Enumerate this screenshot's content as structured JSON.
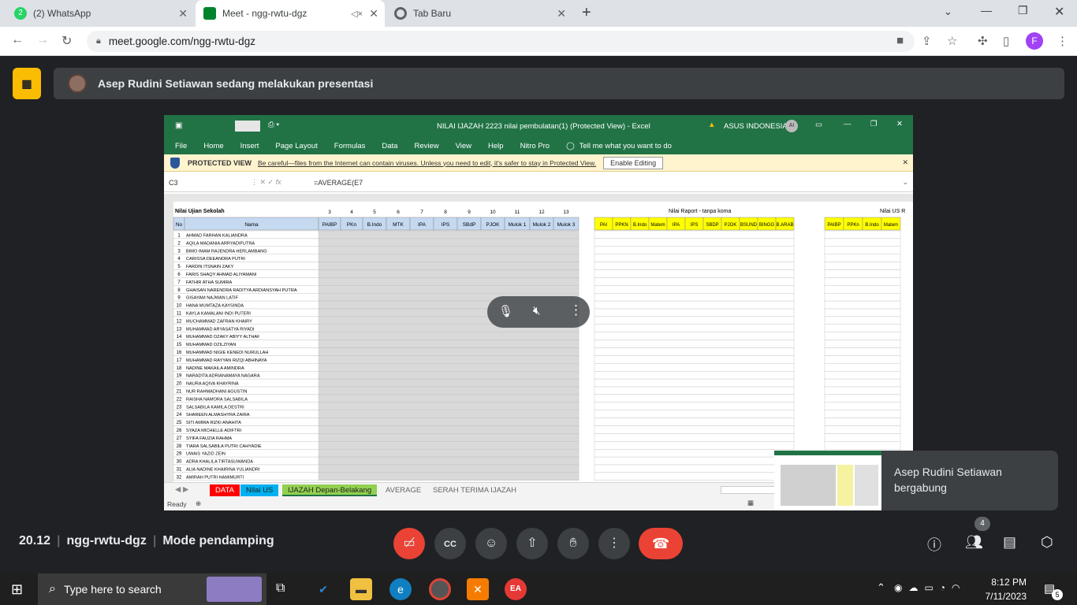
{
  "browser": {
    "tabs": [
      {
        "label": "(2) WhatsApp",
        "badge": "2",
        "icon": "whatsapp-icon",
        "color": "#25d366"
      },
      {
        "label": "Meet - ngg-rwtu-dgz",
        "icon": "meet-icon",
        "color": "#00832d"
      },
      {
        "label": "Tab Baru",
        "icon": "chrome-icon",
        "color": "#5f6368"
      }
    ],
    "url": "meet.google.com/ngg-rwtu-dgz",
    "avatar_letter": "F"
  },
  "presentation": {
    "banner": "Asep Rudini Setiawan sedang melakukan presentasi"
  },
  "excel": {
    "title": "NILAI IJAZAH 2223 nilai pembulatan(1)  (Protected View)  -  Excel",
    "account": "ASUS INDONESIA",
    "account_initials": "AI",
    "ribbon_tabs": [
      "File",
      "Home",
      "Insert",
      "Page Layout",
      "Formulas",
      "Data",
      "Review",
      "View",
      "Help",
      "Nitro Pro",
      "Tell me what you want to do"
    ],
    "protected_label": "PROTECTED VIEW",
    "protected_msg": "Be careful—files from the Internet can contain viruses. Unless you need to edit, it's safer to stay in Protected View.",
    "enable_button": "Enable Editing",
    "name_box": "C3",
    "formula": "=AVERAGE(E7",
    "section_left": "Nilai Ujian Sekolah",
    "section_mid": "Nilai Raport - tanpa koma",
    "section_right": "Nilai US R",
    "left_headers": [
      "No",
      "Nama",
      "PAIBP",
      "PKn",
      "B.Indo",
      "MTK",
      "IPA",
      "IPS",
      "SBdP",
      "PJOK",
      "Mulok 1",
      "Mulok 2",
      "Mulok 3"
    ],
    "col_numbers": [
      "3",
      "4",
      "5",
      "6",
      "7",
      "8",
      "9",
      "10",
      "11",
      "12",
      "13"
    ],
    "mid_headers": [
      "PAI",
      "PPKN",
      "B.Indo",
      "Matem",
      "IPA",
      "IPS",
      "SBDP",
      "PJOK",
      "BSUND",
      "BINGG",
      "B.ARAB"
    ],
    "right_headers": [
      "PAIBP",
      "PPKn",
      "B.Indo",
      "Matem"
    ],
    "students": [
      "AHMAD FARHAN KALIANDRA",
      "AQILA MADANIA ARRYADIFUTRA",
      "BIMO IMAM RAJENDRA HERLAMBANG",
      "CARISSA DEEANDRA PUTRI",
      "FARDIN ITSNAIN ZAKY",
      "FARIS SHAQY AHMAD ALIYAMANI",
      "FATHIR ATHA SUMIRA",
      "GHAISAN NARENDRA RADITYA ARDIANSYAH PUTRA",
      "GISAYAM NAJWAN LATIF",
      "HANA MUMTAZA KAYSINDA",
      "KAYLA KAMALANI INDI PUTERI",
      "MUCHAMMAD ZAFRAN KHAIRY",
      "MUHAMMAD ARYASATYA RIYADI",
      "MUHAMMAD DZAKY ABIYY ALTHAF",
      "MUHAMMAD DZILZIYAN",
      "MUHAMMAD NIGIE KENEDI NURULLAH",
      "MUHAMMAD RAYYAN RIZQI ABHINAYA",
      "NADINE MAKAILA AMINDRA",
      "NARADITA ADRIANAMAYA NAGARA",
      "NAURA AQIVA KHAYRINA",
      "NUR RAHMADHANI AGUSTIN",
      "RAISHA NAMORA SALSABILA",
      "SALSABILA KAMILA DESTRI",
      "SHAREEN ALMASHYRA ZAIRA",
      "SITI AMIRA RIZKI ANAHITA",
      "SYAZA MICHELLE ADIFTRI",
      "SYIFA FAUZIA RAHMA",
      "TIARA SALSABILA PUTRI CAHYADIE",
      "UWAIS YAZID ZEIN",
      "ADRA KHALILA TIRTASUWANDA",
      "ALIA NADINE KHAIRINA YULIANDRI",
      "AMIRAH PUTRI HAMIMURTI"
    ],
    "sheet_tabs": [
      {
        "label": "DATA",
        "bg": "#ff0000",
        "fg": "#ffffff"
      },
      {
        "label": "Nilai US",
        "bg": "#00b0f0",
        "fg": "#ffffff"
      },
      {
        "label": "IJAZAH Depan-Belakang",
        "bg": "#92d050",
        "fg": "#222222"
      },
      {
        "label": "AVERAGE",
        "bg": "#f3f3f3",
        "fg": "#666666"
      },
      {
        "label": "SERAH TERIMA IJAZAH",
        "bg": "#f3f3f3",
        "fg": "#666666"
      }
    ],
    "status": "Ready"
  },
  "toast": "Asep Rudini Setiawan bergabung",
  "meet": {
    "time": "20.12",
    "code": "ngg-rwtu-dgz",
    "mode": "Mode pendamping",
    "people_count": "4"
  },
  "taskbar": {
    "search": "Type here to search",
    "time": "8:12 PM",
    "date": "7/11/2023",
    "notif_count": "5"
  }
}
